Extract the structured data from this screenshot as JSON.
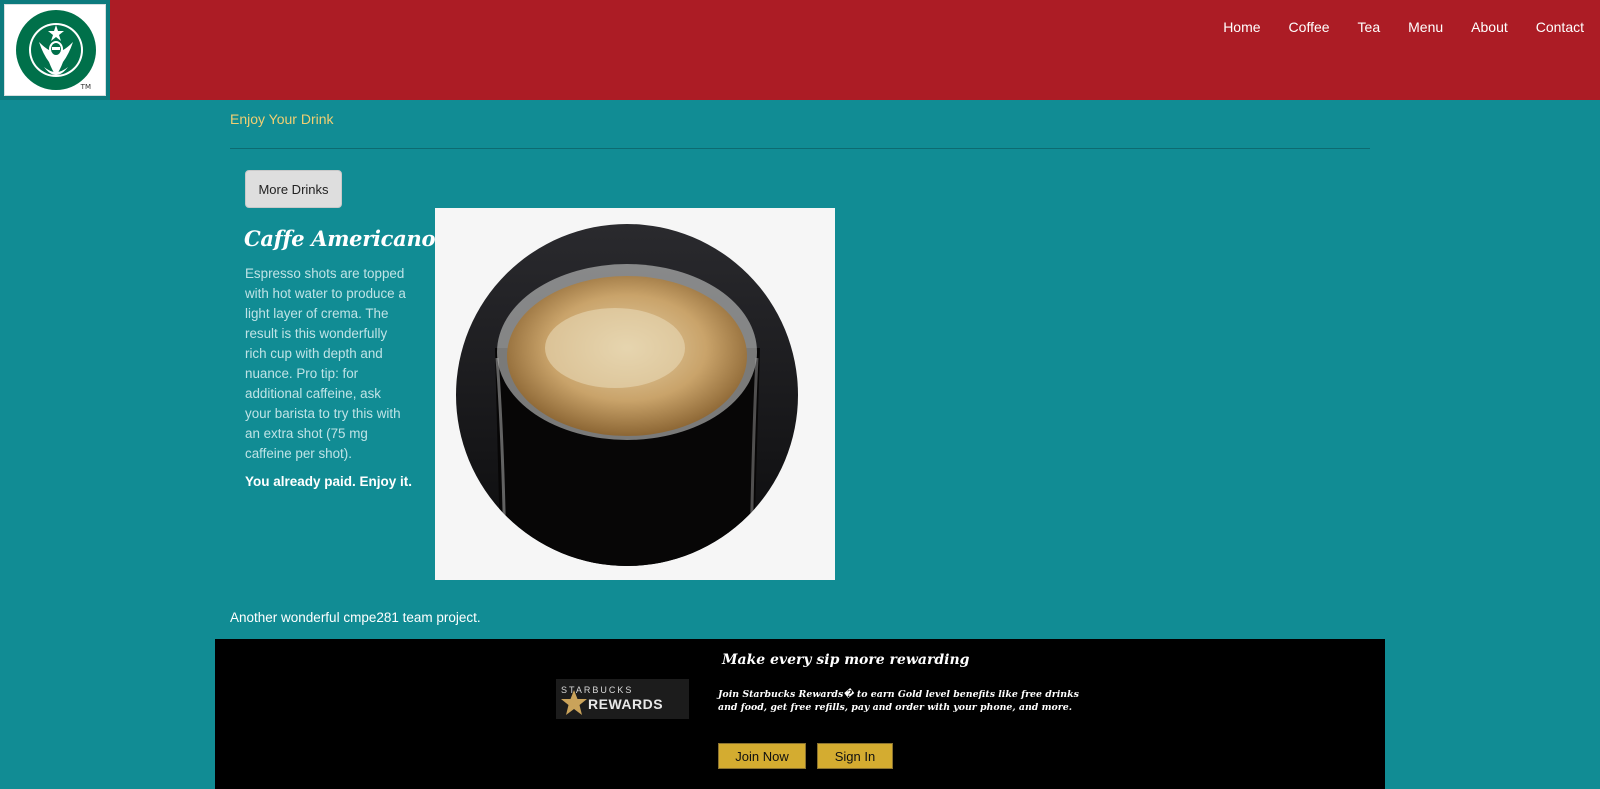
{
  "header": {
    "logo_alt": "Starbucks",
    "logo_tm": "TM",
    "nav": [
      "Home",
      "Coffee",
      "Tea",
      "Menu",
      "About",
      "Contact"
    ]
  },
  "main": {
    "subtitle": "Enjoy Your Drink",
    "more_button": "More Drinks",
    "drink": {
      "name": "Caffe Americano",
      "description": "Espresso shots are topped with hot water to produce a light layer of crema. The result is this wonderfully rich cup with depth and nuance. Pro tip: for additional caffeine, ask your barista to try this with an extra shot (75 mg caffeine per shot).",
      "note": "You already paid. Enjoy it."
    },
    "credit": "Another wonderful cmpe281 team project."
  },
  "footer": {
    "title": "Make every sip more rewarding",
    "logo_top": "STARBUCKS",
    "logo_bottom": "REWARDS",
    "text": "Join Starbucks Rewards� to earn Gold level benefits like free drinks and food, get free refills, pay and order with your phone, and more.",
    "join_label": "Join Now",
    "signin_label": "Sign In"
  },
  "colors": {
    "header_bg": "#ac1c25",
    "page_bg": "#118c94",
    "subtitle": "#f1cf72",
    "footer_bg": "#000000",
    "button_gold": "#d4ac30"
  }
}
